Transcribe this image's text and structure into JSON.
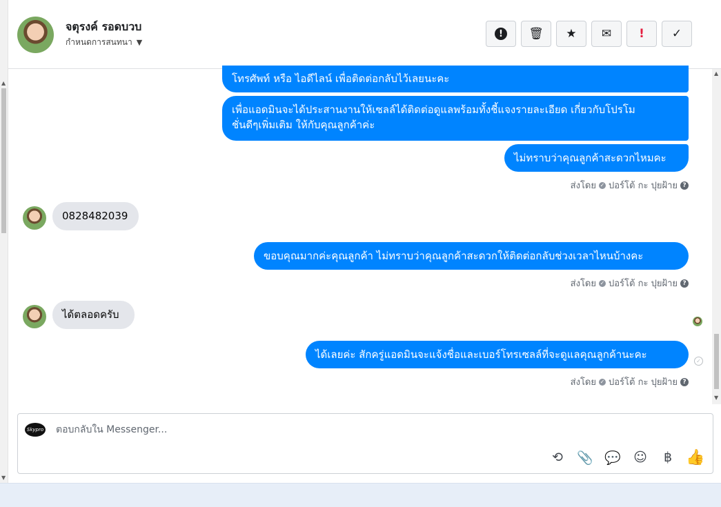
{
  "header": {
    "contact_name": "จตุรงค์ รอดบวบ",
    "subtitle": "กำหนดการสนทนา",
    "buttons": [
      {
        "name": "report-button",
        "icon": "exclamation-circle-icon",
        "label": "!"
      },
      {
        "name": "delete-button",
        "icon": "trash-icon",
        "label": "🗑"
      },
      {
        "name": "star-button",
        "icon": "star-icon",
        "label": "★"
      },
      {
        "name": "mark-unread-button",
        "icon": "envelope-icon",
        "label": "✉"
      },
      {
        "name": "mark-spam-button",
        "icon": "red-exclamation-icon",
        "label": "!"
      },
      {
        "name": "mark-done-button",
        "icon": "check-icon",
        "label": "✓"
      }
    ]
  },
  "messages": [
    {
      "dir": "out",
      "text": "โทรศัพท์ หรือ ไอดีไลน์ เพื่อติดต่อกลับไว้เลยนะคะ"
    },
    {
      "dir": "out",
      "line1": "เพื่อแอดมินจะได้ประสานงานให้เซลล์ได้ติดต่อดูแลพร้อมทั้งชี้แจงรายละเอียด เกี่ยวกับโปรโม",
      "line2": "ชั่นดีๆเพิ่มเติม ให้กับคุณลูกค้าค่ะ"
    },
    {
      "dir": "out",
      "text": "ไม่ทราบว่าคุณลูกค้าสะดวกไหมคะ"
    },
    {
      "dir": "in",
      "text": "0828482039"
    },
    {
      "dir": "out",
      "text": "ขอบคุณมากค่ะคุณลูกค้า ไม่ทราบว่าคุณลูกค้าสะดวกให้ติดต่อกลับช่วงเวลาไหนบ้างคะ"
    },
    {
      "dir": "in",
      "text": "ได้ตลอดครับ"
    },
    {
      "dir": "out",
      "text": "ได้เลยค่ะ สักครู่แอดมินจะแจ้งชื่อและเบอร์โทรเซลล์ที่จะดูแลคุณลูกค้านะคะ"
    }
  ],
  "sent_by": {
    "prefix": "ส่งโดย",
    "agent": "ปอร์โต้ กะ ปุยฝ้าย",
    "help": "?"
  },
  "composer": {
    "placeholder": "ตอบกลับใน Messenger...",
    "logo_text": "Skypro",
    "tools": [
      {
        "name": "saved-reply-icon",
        "glyph": "⟲"
      },
      {
        "name": "attachment-icon",
        "glyph": "📎"
      },
      {
        "name": "chat-bubble-icon",
        "glyph": "💬"
      },
      {
        "name": "emoji-icon",
        "glyph": "☺"
      },
      {
        "name": "baht-icon",
        "glyph": "฿"
      },
      {
        "name": "like-icon",
        "glyph": "👍"
      }
    ]
  },
  "colors": {
    "outgoing_bubble": "#0084ff",
    "incoming_bubble": "#e4e6eb",
    "spam_red": "#e41e3f"
  }
}
